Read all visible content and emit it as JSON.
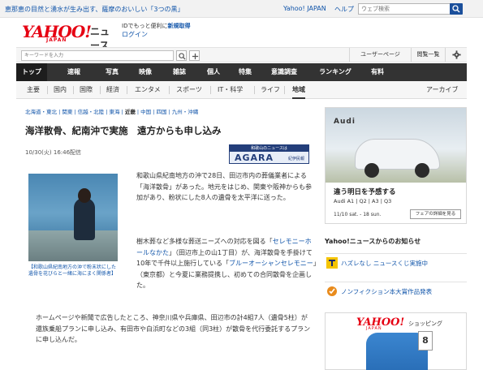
{
  "topbar": {
    "promo": "恵那恵の目然と湧水が生み出す、薩摩のおいしい「3つの黒」",
    "yahoo_japan": "Yahoo! JAPAN",
    "help": "ヘルプ",
    "search_placeholder": "ウェブ検索"
  },
  "header": {
    "logo": "YAHOO!",
    "logo_sub": "JAPAN",
    "service": "ニュース",
    "id_text": "IDでもっと便利に",
    "register": "新規取得",
    "login": "ログイン"
  },
  "keyword": {
    "placeholder": "キーワードを入力",
    "user_page": "ユーザーページ",
    "history": "閲覧一覧"
  },
  "nav_primary": [
    "トップ",
    "速報",
    "写真",
    "映像",
    "雑誌",
    "個人",
    "特集",
    "意識調査",
    "ランキング",
    "有料"
  ],
  "nav_secondary": [
    "主要",
    "国内",
    "国際",
    "経済",
    "エンタメ",
    "スポーツ",
    "IT・科学",
    "ライフ",
    "地域",
    "アーカイブ"
  ],
  "article": {
    "regions": [
      "北海道・東北",
      "関東",
      "信越・北陸",
      "東海",
      "近畿",
      "中国",
      "四国",
      "九州・沖縄"
    ],
    "current_region": "近畿",
    "title": "海洋散骨、紀南沖で実施　遠方からも申し込み",
    "date": "10/30(火) 16:46配信",
    "source_top": "和歌山のニュースは",
    "source_main": "AGARA",
    "source_small": "紀伊民報",
    "caption": "【和歌山県紀南地方の沖で粉末状にした遺骨を花びらと一緒に海にまく関係者】",
    "p1": "和歌山県紀南地方の沖で28日、田辺市内の葬儀業者による「海洋散骨」があった。地元をはじめ、関東や阪神からも参加があり、粉状にした8人の遺骨を太平洋に送った。",
    "p2a": "樹木葬など多様な葬送ニーズへの対応を図る「",
    "p2_link1": "セレモニーホールなかた",
    "p2b": "」（田辺市上の山1丁目）が、海洋散骨を手掛けて10年で千件以上施行している「",
    "p2_link2": "ブルーオーシャンセレモニー",
    "p2c": "」（東京都）と今夏に業務提携し、初めての合同散骨を企画した。",
    "p3": "ホームページや新聞で広告したところ、神奈川県や兵庫県、田辺市の計4組7人（遺骨5柱）が還族乗船プランに申し込み、有田市や白浜町などの3組（同3柱）が散骨を代行委託するプランに申し込んだ。"
  },
  "ad": {
    "brand": "Audi",
    "title": "違う明日を予感する",
    "models": "Audi A1 | Q2 | A3 | Q3",
    "date": "11/10 sat. - 18 sun.",
    "button": "フェアの詳細を見る"
  },
  "notices": {
    "heading": "Yahoo!ニュースからのお知らせ",
    "items": [
      "ハズレなし ニュースくじ実施中",
      "ノンフィクション本大賞作品発表"
    ]
  },
  "shopping": {
    "logo": "YAHOO!",
    "logo_sub": "JAPAN",
    "label": "ショッピング",
    "badge": "8"
  }
}
